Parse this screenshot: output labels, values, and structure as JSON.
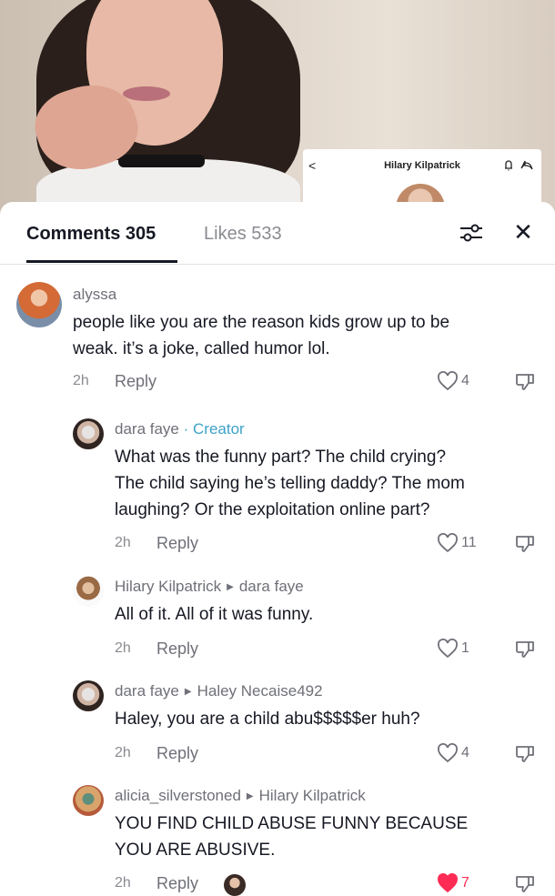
{
  "video": {
    "mini_title": "Hilary Kilpatrick"
  },
  "tabs": {
    "comments": "Comments 305",
    "likes": "Likes 533"
  },
  "comments": [
    {
      "user": "alyssa",
      "text_lines": [
        "people like you are the reason kids grow up to be",
        "weak. it’s a joke, called humor lol."
      ],
      "time": "2h",
      "reply": "Reply",
      "likes": "4"
    },
    {
      "user": "dara faye",
      "creator": "· Creator",
      "text_lines": [
        "What was the funny part? The child crying?",
        "The child saying he’s telling daddy? The mom",
        "laughing? Or the exploitation online part?"
      ],
      "time": "2h",
      "reply": "Reply",
      "likes": "11"
    },
    {
      "user": "Hilary Kilpatrick",
      "reply_to": "dara faye",
      "text_lines": [
        "All of it. All of it was funny."
      ],
      "time": "2h",
      "reply": "Reply",
      "likes": "1"
    },
    {
      "user": "dara faye",
      "reply_to": "Haley Necaise492",
      "text_lines": [
        "Haley, you are a child abu$$$$$er huh?"
      ],
      "time": "2h",
      "reply": "Reply",
      "likes": "4"
    },
    {
      "user": "alicia_silverstoned",
      "reply_to": "Hilary Kilpatrick",
      "text_lines": [
        "YOU FIND CHILD ABUSE FUNNY BECAUSE",
        "YOU ARE ABUSIVE."
      ],
      "time": "2h",
      "reply": "Reply",
      "likes": "7",
      "liked_color": "#fe2c55"
    }
  ]
}
